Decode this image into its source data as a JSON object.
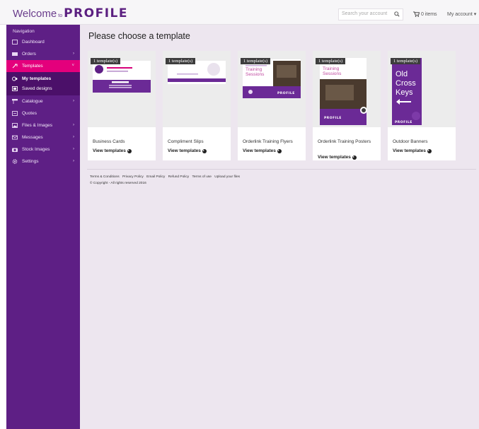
{
  "header": {
    "welcome": "Welcome",
    "to": "to",
    "brand": "PROFILE",
    "search_placeholder": "Search your account",
    "cart": "0 items",
    "account": "My account ▾"
  },
  "sidebar": {
    "title": "Navigation",
    "items": [
      {
        "label": "Dashboard"
      },
      {
        "label": "Orders",
        "chevron": "›"
      },
      {
        "label": "Templates",
        "chevron": "˅"
      },
      {
        "label": "Catalogue",
        "chevron": "›"
      },
      {
        "label": "Quotes"
      },
      {
        "label": "Files & Images",
        "chevron": "›"
      },
      {
        "label": "Messages",
        "chevron": "›"
      },
      {
        "label": "Stock Images",
        "chevron": "›"
      },
      {
        "label": "Settings",
        "chevron": "›"
      }
    ],
    "subitems": [
      {
        "label": "My templates"
      },
      {
        "label": "Saved designs"
      }
    ]
  },
  "main": {
    "title": "Please choose a template",
    "badge_text": "1 template(s)",
    "link_text": "View templates",
    "cards": [
      {
        "title": "Business Cards"
      },
      {
        "title": "Compliment Slips"
      },
      {
        "title": "Orderlink Training Flyers"
      },
      {
        "title": "Orderlink Training Posters"
      },
      {
        "title": "Outdoor Banners"
      }
    ],
    "thumb_text": {
      "training": "Training Sessions",
      "banner": "Old Cross Keys",
      "profile": "PROFILE"
    }
  },
  "footer": {
    "links": [
      "Terms & Conditions",
      "Privacy Policy",
      "Email Policy",
      "Refund Policy",
      "Terms of use",
      "Upload your files"
    ],
    "copyright": "© Copyright - All rights reserved 2016"
  },
  "colors": {
    "purple": "#5e1f85",
    "magenta": "#e4007c",
    "main_bg": "#ede6ef"
  }
}
